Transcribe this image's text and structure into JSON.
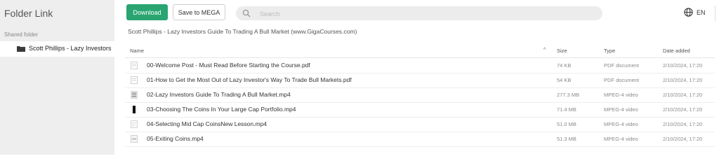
{
  "sidebar": {
    "title": "Folder Link",
    "section_label": "Shared folder",
    "folder_name": "Scott Phillips - Lazy Investors"
  },
  "toolbar": {
    "download_label": "Download",
    "save_label": "Save to MEGA",
    "search_placeholder": "Search",
    "language": "EN"
  },
  "breadcrumb": "Scott Phillips - Lazy Investors Guide To Trading A Bull Market (www.GigaCourses.com)",
  "table": {
    "headers": {
      "name": "Name",
      "size": "Size",
      "type": "Type",
      "date": "Date added"
    },
    "sort_indicator": "^",
    "rows": [
      {
        "name": "00-Welcome Post - Must Read Before Starting the Course.pdf",
        "size": "74 KB",
        "type": "PDF document",
        "date": "2/10/2024, 17:20",
        "icon": "pdf-file-icon"
      },
      {
        "name": "01-How to Get the Most Out of Lazy Investor's Way To Trade Bull Markets.pdf",
        "size": "54 KB",
        "type": "PDF document",
        "date": "2/10/2024, 17:20",
        "icon": "pdf-file-icon"
      },
      {
        "name": "02-Lazy Investors Guide To Trading A Bull Market.mp4",
        "size": "277.3 MB",
        "type": "MPEG-4 video",
        "date": "2/10/2024, 17:20",
        "icon": "video-thumbnail-icon"
      },
      {
        "name": "03-Choosing The Coins In Your Large Cap Portfolio.mp4",
        "size": "71.4 MB",
        "type": "MPEG-4 video",
        "date": "2/10/2024, 17:20",
        "icon": "video-thumbnail-icon"
      },
      {
        "name": "04-Selecting Mid Cap CoinsNew Lesson.mp4",
        "size": "51.0 MB",
        "type": "MPEG-4 video",
        "date": "2/10/2024, 17:20",
        "icon": "video-thumbnail-icon"
      },
      {
        "name": "05-Exiting Coins.mp4",
        "size": "51.3 MB",
        "type": "MPEG-4 video",
        "date": "2/10/2024, 17:20",
        "icon": "video-thumbnail-icon"
      }
    ]
  },
  "colors": {
    "accent": "#2aa572",
    "sidebar_bg": "#eeeeee",
    "search_bg": "#ececec"
  }
}
